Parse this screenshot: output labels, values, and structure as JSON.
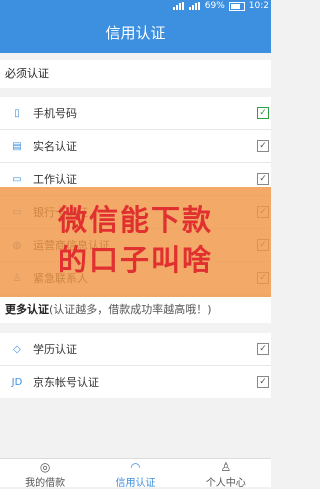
{
  "status": {
    "signal": "",
    "battery_pct": "69%",
    "time": "10:2"
  },
  "header": {
    "title": "信用认证"
  },
  "required": {
    "title": "必须认证",
    "items": [
      {
        "label": "手机号码",
        "icon": "phone-icon",
        "glyph": "▯",
        "check_style": "green"
      },
      {
        "label": "实名认证",
        "icon": "id-card-icon",
        "glyph": "▤",
        "check_style": "gray"
      },
      {
        "label": "工作认证",
        "icon": "briefcase-icon",
        "glyph": "▭",
        "check_style": "gray"
      },
      {
        "label": "银行卡认证",
        "icon": "bank-card-icon",
        "glyph": "▭",
        "check_style": "gray"
      },
      {
        "label": "运营商信息认证",
        "icon": "globe-icon",
        "glyph": "◍",
        "check_style": "gray"
      },
      {
        "label": "紧急联系人",
        "icon": "person-icon",
        "glyph": "♙",
        "check_style": "gray"
      }
    ]
  },
  "more": {
    "title": "更多认证",
    "subtitle": "(认证越多，借款成功率越高哦！)",
    "items": [
      {
        "label": "学历认证",
        "icon": "graduation-cap-icon",
        "glyph": "◇",
        "check_style": "gray"
      },
      {
        "label": "京东帐号认证",
        "icon": "jd-icon",
        "glyph": "JD",
        "check_style": "gray"
      }
    ]
  },
  "overlay": {
    "line1": "微信能下款",
    "line2": "的口子叫啥"
  },
  "bottom_nav": [
    {
      "label": "我的借款",
      "icon": "wallet-icon",
      "glyph": "◎"
    },
    {
      "label": "信用认证",
      "icon": "shield-icon",
      "glyph": "◠",
      "active": true
    },
    {
      "label": "个人中心",
      "icon": "user-icon",
      "glyph": "♙"
    }
  ],
  "colors": {
    "accent": "#3d8fe0",
    "overlay_bg": "#f09646",
    "overlay_text": "#e13030",
    "check_green": "#2e9e45"
  }
}
